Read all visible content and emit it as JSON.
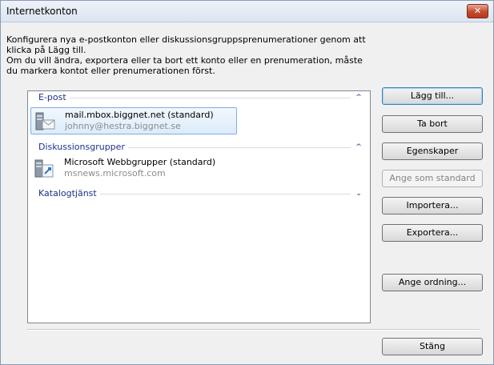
{
  "window": {
    "title": "Internetkonton",
    "close_label": "✕"
  },
  "description": {
    "line1": "Konfigurera nya e-postkonton eller diskussionsgruppsprenumerationer genom att klicka på Lägg till.",
    "line2": "Om du vill ändra, exportera eller ta bort ett konto eller en prenumeration, måste du markera kontot eller prenumerationen först."
  },
  "groups": {
    "email": {
      "label": "E-post",
      "chevron": "^",
      "account": {
        "name": "mail.mbox.biggnet.net (standard)",
        "address": "johnny@hestra.biggnet.se"
      }
    },
    "news": {
      "label": "Diskussionsgrupper",
      "chevron": "^",
      "account": {
        "name": "Microsoft Webbgrupper (standard)",
        "address": "msnews.microsoft.com"
      }
    },
    "directory": {
      "label": "Katalogtjänst",
      "chevron": "⌄"
    }
  },
  "buttons": {
    "add": "Lägg till...",
    "remove": "Ta bort",
    "properties": "Egenskaper",
    "set_default": "Ange som standard",
    "import": "Importera...",
    "export": "Exportera...",
    "order": "Ange ordning...",
    "close": "Stäng"
  },
  "colors": {
    "group_label": "#1e3287",
    "selection": "#dcecfc",
    "close_button": "#c44a2d"
  }
}
